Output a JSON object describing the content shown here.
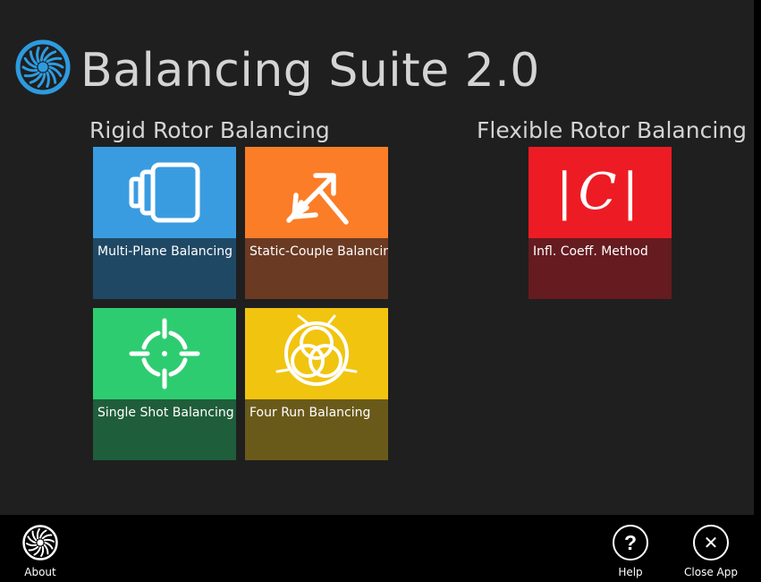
{
  "app": {
    "title": "Balancing Suite 2.0",
    "logo_icon": "turbine-fan-icon",
    "accent_color": "#2d9be0"
  },
  "groups": {
    "rigid": {
      "title": "Rigid Rotor Balancing"
    },
    "flexible": {
      "title": "Flexible Rotor Balancing"
    }
  },
  "tiles": {
    "multi_plane": {
      "label": "Multi-Plane Balancing",
      "icon": "rotor-planes-icon",
      "color_top": "#3a9ce0",
      "color_bottom": "#1f4865"
    },
    "static_couple": {
      "label": "Static-Couple Balancing",
      "icon": "diverging-arrows-icon",
      "color_top": "#fb7d28",
      "color_bottom": "#6b3a22"
    },
    "single_shot": {
      "label": "Single Shot Balancing",
      "icon": "crosshair-target-icon",
      "color_top": "#2ecc71",
      "color_bottom": "#1f5e3a"
    },
    "four_run": {
      "label": "Four Run Balancing",
      "icon": "four-run-circles-icon",
      "color_top": "#f1c40f",
      "color_bottom": "#6a5a1a"
    },
    "infl_coeff": {
      "label": "Infl. Coeff. Method",
      "icon": "matrix-c-icon",
      "icon_text": "|C|",
      "color_top": "#ed1c24",
      "color_bottom": "#651b20"
    }
  },
  "appbar": {
    "about": {
      "label": "About",
      "icon": "turbine-fan-icon"
    },
    "help": {
      "label": "Help",
      "icon": "question-icon",
      "glyph": "?"
    },
    "close": {
      "label": "Close App",
      "icon": "close-icon",
      "glyph": "✕"
    }
  }
}
